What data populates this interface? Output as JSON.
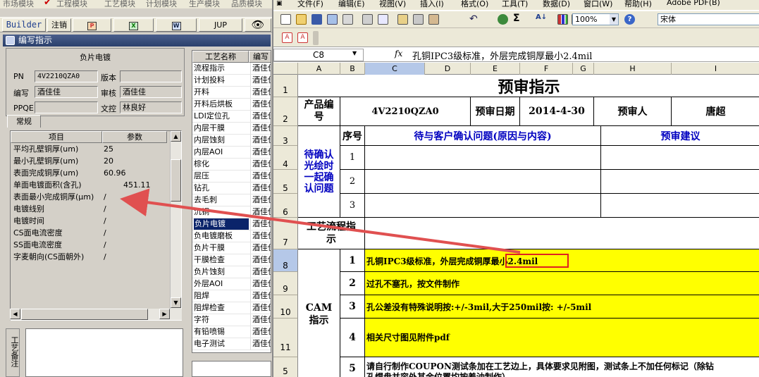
{
  "left_app": {
    "modules": [
      "市场模块",
      "工程模块",
      "工艺模块",
      "计划模块",
      "生产模块",
      "品质模块"
    ],
    "toolbar": {
      "builder": "Builder",
      "logout": "注销",
      "jup": "JUP"
    },
    "panel_title": "编写指示",
    "form": {
      "title": "负片电镀",
      "pn_label": "PN",
      "pn_value": "4V2210QZA0",
      "version_label": "版本",
      "version_value": "",
      "writer_label": "编写",
      "writer_value": "酒佳佳",
      "review_label": "审核",
      "review_value": "酒佳佳",
      "ppqe_label": "PPQE",
      "ppqe_value": "",
      "doc_review_label": "文控",
      "doc_review_value": "林良好"
    },
    "tab_label": "常规",
    "param_grid": {
      "headers": [
        "项目",
        "参数"
      ],
      "rows": [
        [
          "平均孔壁铜厚(um)",
          "25"
        ],
        [
          "最小孔壁铜厚(um)",
          "20"
        ],
        [
          "表面完成铜厚(um)",
          "60.96"
        ],
        [
          "单面电镀面积(含孔)",
          "451.11"
        ],
        [
          "表面最小完成铜厚(μm)",
          "/"
        ],
        [
          "电镀线别",
          "/"
        ],
        [
          "电镀时间",
          "/"
        ],
        [
          "CS面电流密度",
          "/"
        ],
        [
          "SS面电流密度",
          "/"
        ],
        [
          "字麦朝向(CS面朝外)",
          "/"
        ]
      ]
    },
    "process_list": {
      "headers": [
        "工艺名称",
        "编写"
      ],
      "rows": [
        [
          "流程指示",
          "酒佳佳"
        ],
        [
          "计划投料",
          "酒佳佳"
        ],
        [
          "开料",
          "酒佳佳"
        ],
        [
          "开料后烘板",
          "酒佳佳"
        ],
        [
          "LDI定位孔",
          "酒佳佳"
        ],
        [
          "内层干膜",
          "酒佳佳"
        ],
        [
          "内层蚀刻",
          "酒佳佳"
        ],
        [
          "内层AOI",
          "酒佳佳"
        ],
        [
          "棕化",
          "酒佳佳"
        ],
        [
          "层压",
          "酒佳佳"
        ],
        [
          "钻孔",
          "酒佳佳"
        ],
        [
          "去毛刺",
          "酒佳佳"
        ],
        [
          "沉铜",
          "酒佳佳"
        ],
        [
          "负片电镀",
          "酒佳佳"
        ],
        [
          "负电镀磨板",
          "酒佳佳"
        ],
        [
          "负片干膜",
          "酒佳佳"
        ],
        [
          "干膜检查",
          "酒佳佳"
        ],
        [
          "负片蚀刻",
          "酒佳佳"
        ],
        [
          "外层AOI",
          "酒佳佳"
        ],
        [
          "阻焊",
          "酒佳佳"
        ],
        [
          "阻焊检查",
          "酒佳佳"
        ],
        [
          "字符",
          "酒佳佳"
        ],
        [
          "有铅喷锡",
          "酒佳佳"
        ],
        [
          "电子测试",
          "酒佳佳"
        ]
      ],
      "selected_index": 13
    },
    "side_label": "工艺备注"
  },
  "excel": {
    "menus": [
      "文件(F)",
      "编辑(E)",
      "视图(V)",
      "插入(I)",
      "格式(O)",
      "工具(T)",
      "数据(D)",
      "窗口(W)",
      "帮助(H)",
      "Adobe PDF(B)"
    ],
    "zoom": "100%",
    "font": "宋体",
    "name_box": "C8",
    "fx": "fx",
    "formula": "孔铜IPC3级标准，外层完成铜厚最小2.4mil",
    "columns": [
      "A",
      "B",
      "C",
      "D",
      "E",
      "F",
      "G",
      "H",
      "I"
    ],
    "rows": [
      "1",
      "2",
      "3",
      "4",
      "5",
      "6",
      "7",
      "8",
      "9",
      "10",
      "11",
      "5"
    ],
    "sheet": {
      "title": "预审指示",
      "product_label": "产品编号",
      "product_value": "4V2210QZA0",
      "date_label": "预审日期",
      "date_value": "2014-4-30",
      "reviewer_label": "预审人",
      "reviewer_value": "唐超",
      "seq_label": "序号",
      "issue_header": "待与客户确认问题(原因与内容)",
      "suggest_header": "预审建议",
      "confirm_label": "待确认光绘时一起确认问题",
      "process_label": "工艺流程指示",
      "cam_label": "CAM指示",
      "seq": [
        "1",
        "2",
        "3"
      ],
      "cam_seq": [
        "1",
        "2",
        "3",
        "4",
        "5"
      ],
      "cam_items": [
        "孔铜IPC3级标准，外层完成铜厚最小2.4mil",
        "过孔不塞孔，按文件制作",
        "孔公差没有特殊说明按:+/-3mil,大于250mil按: +/-5mil",
        "相关尺寸图见附件pdf",
        "请自行制作COUPON测试条加在工艺边上，具体要求见附图，测试条上不加任何标记（除钻",
        "孔焊盘并容外其余位置均按着油制作）"
      ]
    }
  },
  "annotation_color": "#e05050"
}
